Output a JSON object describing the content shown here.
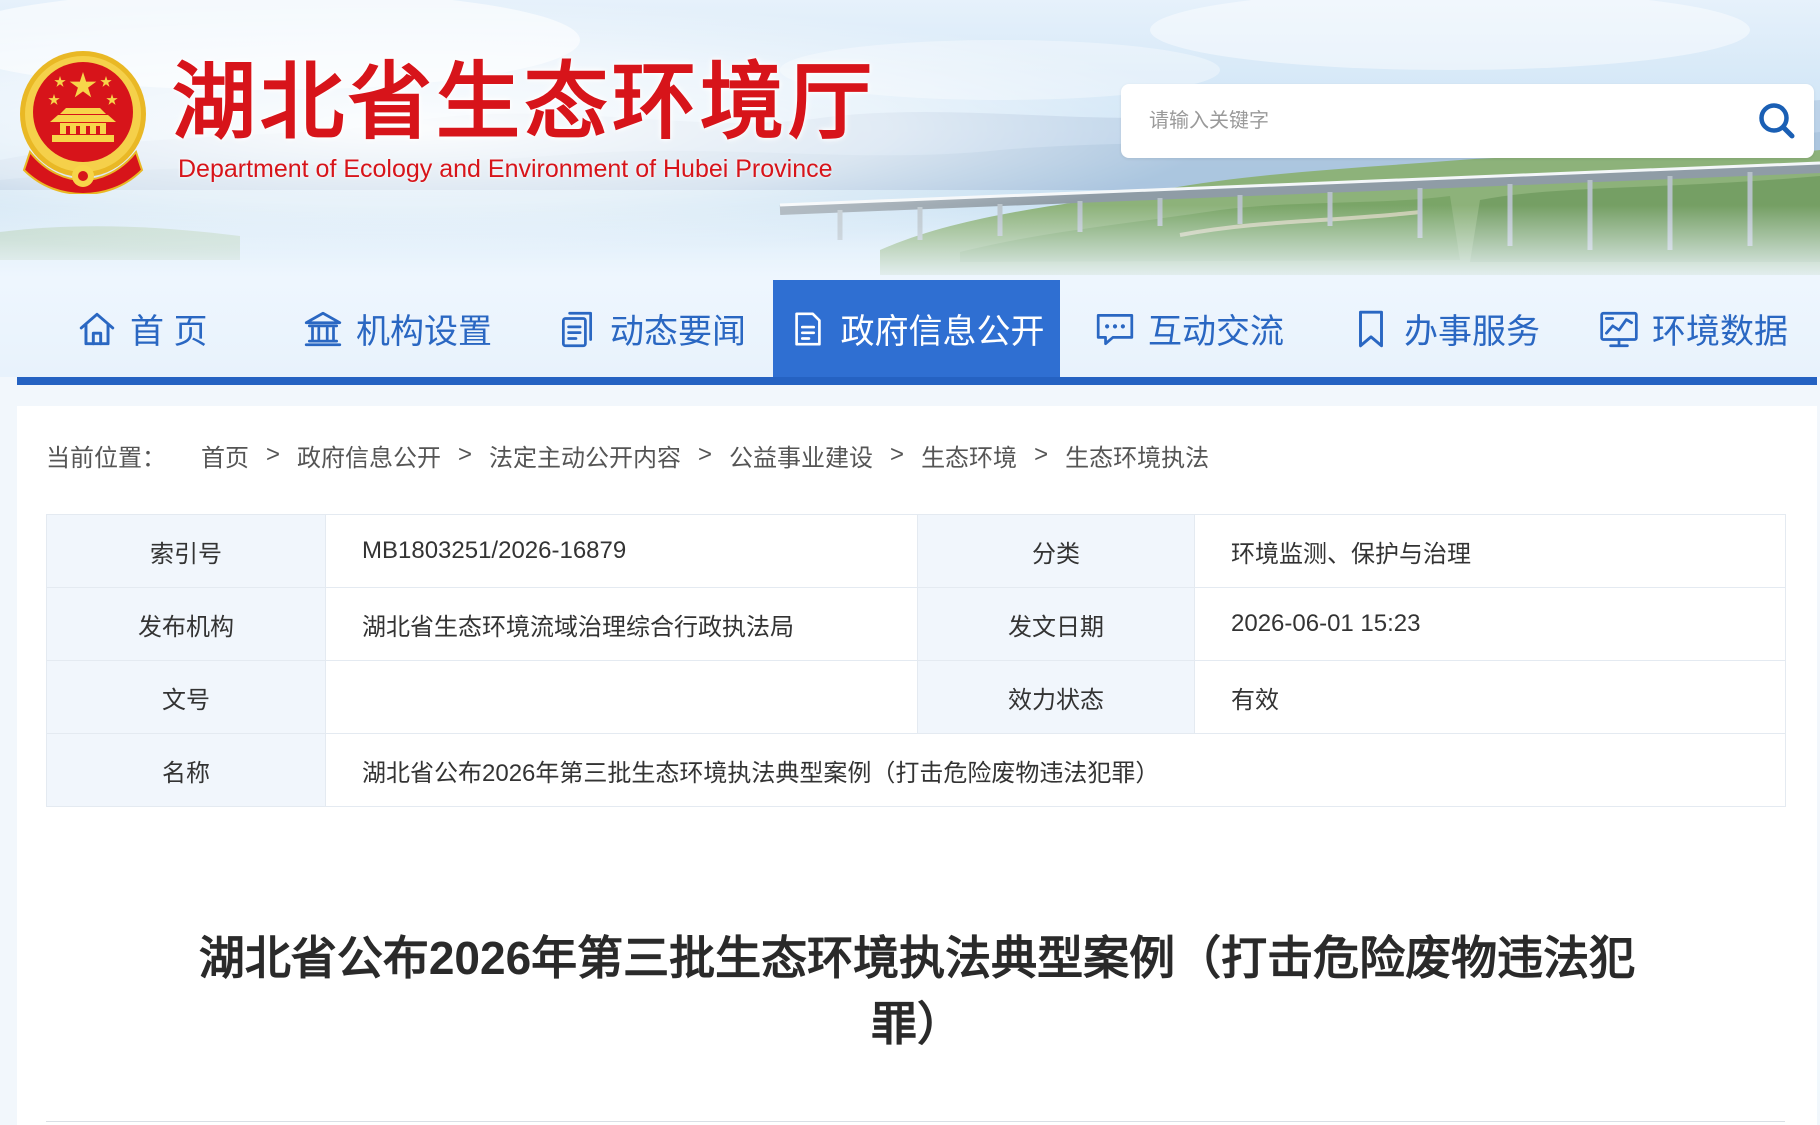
{
  "header": {
    "title": "湖北省生态环境厅",
    "subtitle": "Department of Ecology and Environment of Hubei Province",
    "emblem_icon": "national-emblem-icon"
  },
  "search": {
    "placeholder": "请输入关键字",
    "icon": "search-icon"
  },
  "nav": {
    "items": [
      {
        "label": "首 页",
        "icon": "home-icon",
        "active": false
      },
      {
        "label": "机构设置",
        "icon": "building-icon",
        "active": false
      },
      {
        "label": "动态要闻",
        "icon": "news-document-icon",
        "active": false
      },
      {
        "label": "政府信息公开",
        "icon": "file-text-icon",
        "active": true
      },
      {
        "label": "互动交流",
        "icon": "chat-bubble-icon",
        "active": false
      },
      {
        "label": "办事服务",
        "icon": "bookmark-icon",
        "active": false
      },
      {
        "label": "环境数据",
        "icon": "data-monitor-icon",
        "active": false
      }
    ]
  },
  "breadcrumb": {
    "prefix": "当前位置：",
    "separator": ">",
    "items": [
      "首页",
      "政府信息公开",
      "法定主动公开内容",
      "公益事业建设",
      "生态环境",
      "生态环境执法"
    ]
  },
  "meta": {
    "rows": [
      {
        "label1": "索引号",
        "value1": "MB1803251/2026-16879",
        "label2": "分类",
        "value2": "环境监测、保护与治理"
      },
      {
        "label1": "发布机构",
        "value1": "湖北省生态环境流域治理综合行政执法局",
        "label2": "发文日期",
        "value2": "2026-06-01 15:23"
      },
      {
        "label1": "文号",
        "label2": "效力状态",
        "value2": "有效"
      },
      {
        "label1": "名称",
        "value1": "湖北省公布2026年第三批生态环境执法典型案例（打击危险废物违法犯罪）"
      }
    ]
  },
  "article": {
    "title": "湖北省公布2026年第三批生态环境执法典型案例（打击危险废物违法犯罪）"
  },
  "colors": {
    "brand_red": "#d7141a",
    "nav_blue": "#2a67c2",
    "active_bg": "#2f6fd2",
    "label_bg": "#f1f6fc",
    "line_blue": "#2562c2"
  }
}
